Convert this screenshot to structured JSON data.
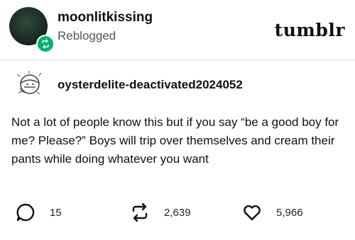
{
  "header": {
    "username": "moonlitkissing",
    "status": "Reblogged",
    "logo": "tumblr",
    "avatar_icon": "avatar",
    "badge_icon": "reblog-icon",
    "badge_color": "#00b36b"
  },
  "original_post": {
    "username": "oysterdelite-deactivated2024052",
    "avatar_icon": "sketch-avatar",
    "body": "Not a lot of people know this but if you say “be a good boy for me? Please?” Boys will trip over themselves and cream their pants while doing whatever you want"
  },
  "actions": {
    "replies": {
      "icon": "comment-icon",
      "count": "15"
    },
    "reblogs": {
      "icon": "reblog-icon",
      "count": "2,639"
    },
    "likes": {
      "icon": "heart-icon",
      "count": "5,966"
    }
  }
}
